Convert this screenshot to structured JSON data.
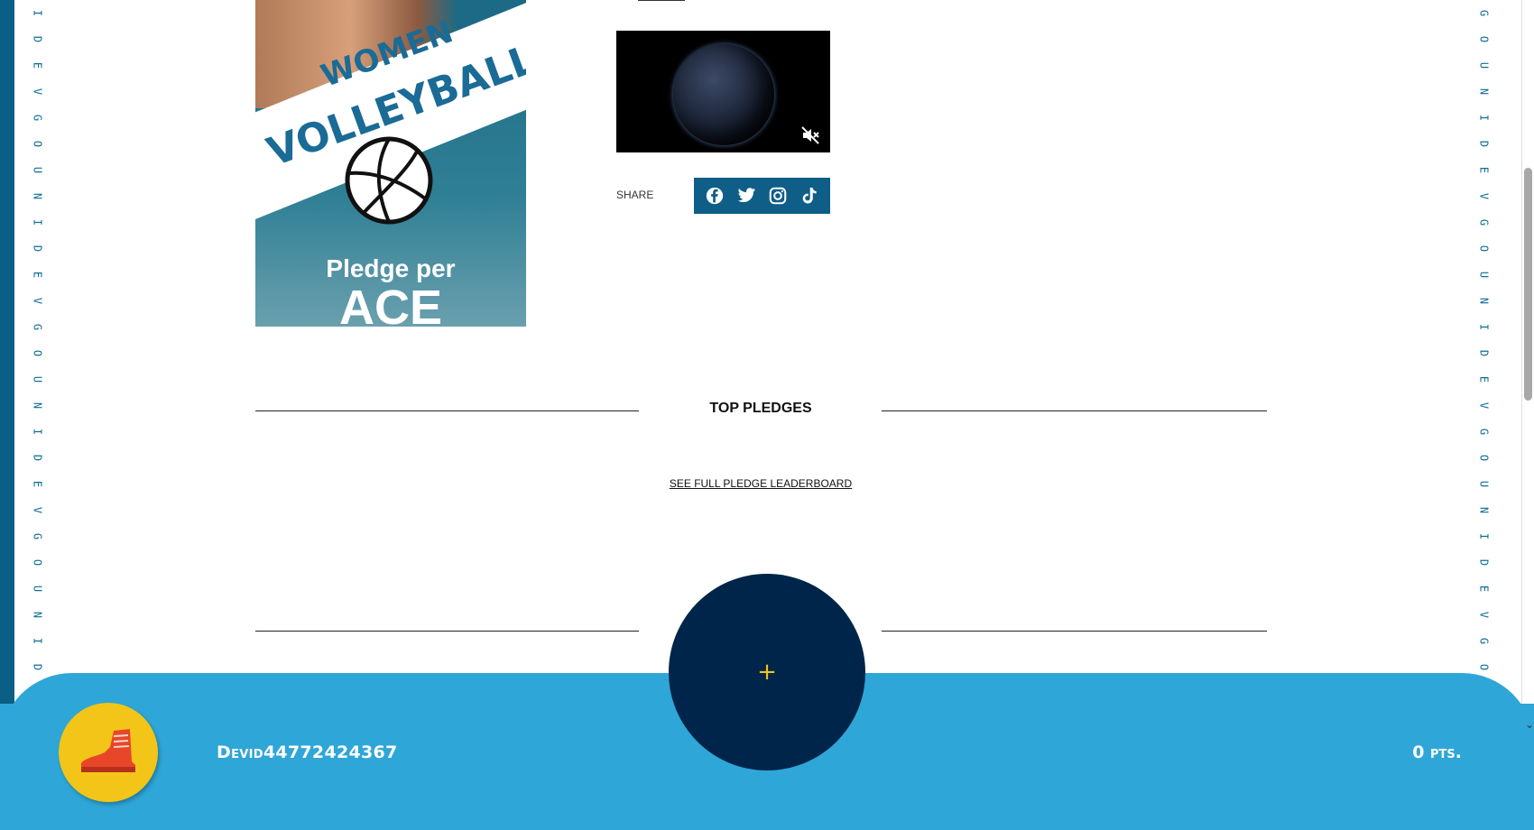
{
  "side_pattern": [
    "U",
    "N",
    "I",
    "D",
    "E",
    "V",
    "G",
    "O"
  ],
  "poster": {
    "line1": "WOMEN",
    "line2": "VOLLEYBALL",
    "pledge": "Pledge per",
    "ace": "ACE"
  },
  "share": {
    "label": "SHARE",
    "icons": [
      "facebook-icon",
      "twitter-icon",
      "instagram-icon",
      "tiktok-icon"
    ]
  },
  "pledges": {
    "title": "TOP PLEDGES",
    "leaderboard_link": "SEE FULL PLEDGE LEADERBOARD"
  },
  "add_button": {
    "label": "+"
  },
  "user": {
    "name": "Devid44772424367",
    "points": "0 pts."
  },
  "colors": {
    "frame": "#0a5f86",
    "bar": "#2fa6d8",
    "circle": "#00254a",
    "accent": "#f0c419",
    "avatar": "#f2c518"
  }
}
